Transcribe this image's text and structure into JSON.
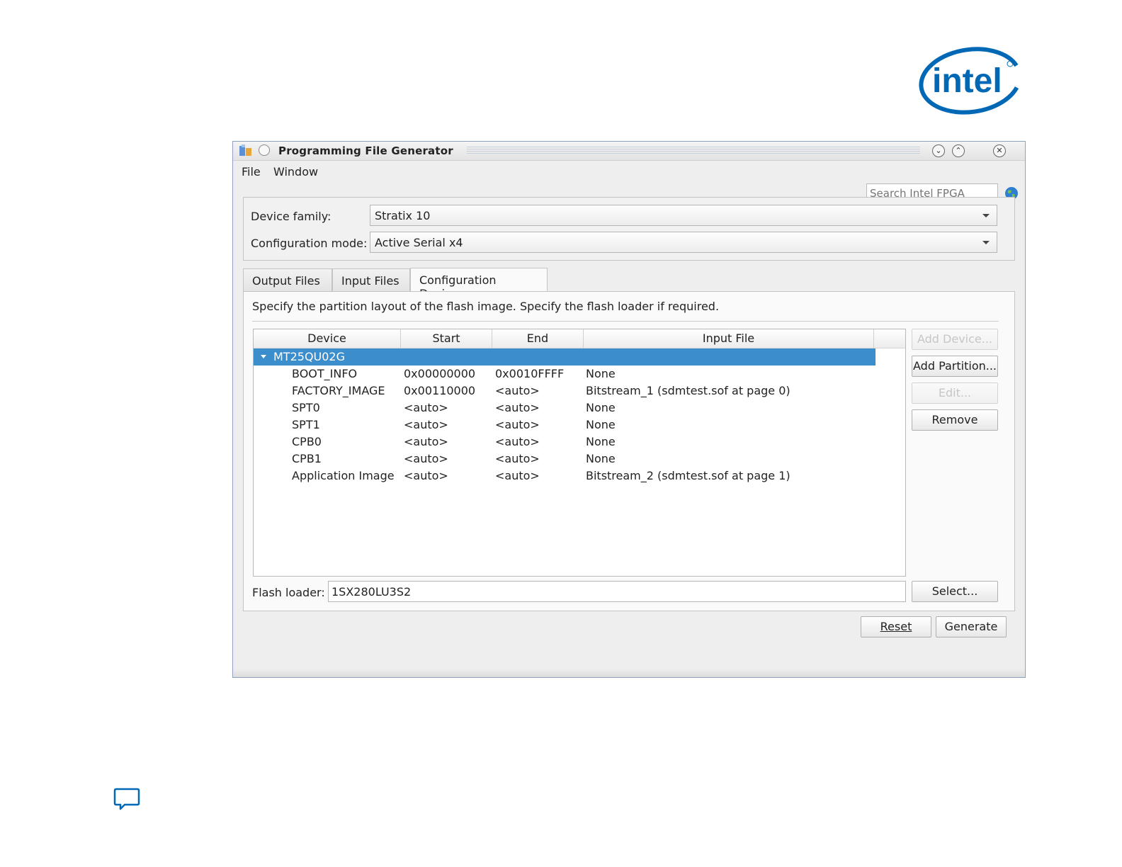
{
  "brand": {
    "logo_text": "intel",
    "logo_color": "#0068b5"
  },
  "window": {
    "title": "Programming File Generator",
    "menu": {
      "file": "File",
      "window": "Window"
    },
    "search_placeholder": "Search Intel FPGA"
  },
  "settings": {
    "device_family_label": "Device family:",
    "device_family_value": "Stratix 10",
    "config_mode_label": "Configuration mode:",
    "config_mode_value": "Active Serial x4"
  },
  "tabs": [
    {
      "label": "Output Files",
      "active": false
    },
    {
      "label": "Input Files",
      "active": false
    },
    {
      "label": "Configuration Device",
      "active": true
    }
  ],
  "panel": {
    "description": "Specify the partition layout of the flash image. Specify the flash loader if required.",
    "columns": [
      "Device",
      "Start",
      "End",
      "Input File"
    ],
    "device": "MT25QU02G",
    "partitions": [
      {
        "name": "BOOT_INFO",
        "start": "0x00000000",
        "end": "0x0010FFFF",
        "input": "None"
      },
      {
        "name": "FACTORY_IMAGE",
        "start": "0x00110000",
        "end": "<auto>",
        "input": "Bitstream_1 (sdmtest.sof at page 0)"
      },
      {
        "name": "SPT0",
        "start": "<auto>",
        "end": "<auto>",
        "input": "None"
      },
      {
        "name": "SPT1",
        "start": "<auto>",
        "end": "<auto>",
        "input": "None"
      },
      {
        "name": "CPB0",
        "start": "<auto>",
        "end": "<auto>",
        "input": "None"
      },
      {
        "name": "CPB1",
        "start": "<auto>",
        "end": "<auto>",
        "input": "None"
      },
      {
        "name": "Application Image",
        "start": "<auto>",
        "end": "<auto>",
        "input": "Bitstream_2 (sdmtest.sof at page 1)"
      }
    ],
    "buttons": {
      "add_device": "Add Device...",
      "add_partition": "Add Partition...",
      "edit": "Edit...",
      "remove": "Remove"
    },
    "flash_loader_label": "Flash loader:",
    "flash_loader_value": "1SX280LU3S2",
    "select_label": "Select..."
  },
  "footer": {
    "reset": "Reset",
    "generate": "Generate"
  },
  "colors": {
    "selection": "#3c8dcc",
    "window_border": "#8ea3c0"
  }
}
